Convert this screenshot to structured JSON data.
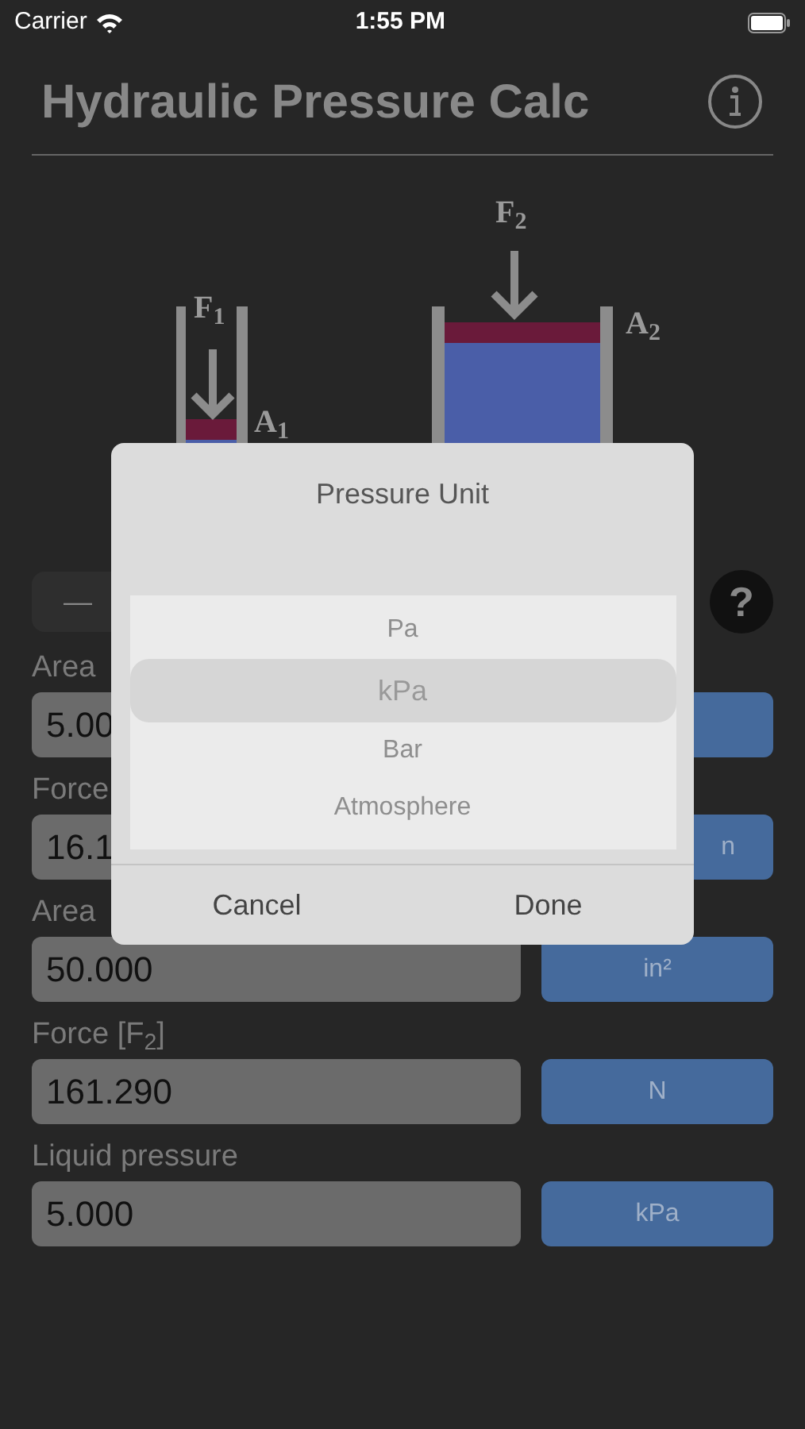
{
  "status_bar": {
    "carrier": "Carrier",
    "time": "1:55 PM"
  },
  "header": {
    "title": "Hydraulic Pressure Calc"
  },
  "diagram": {
    "labels": [
      {
        "kind": "f1",
        "text": "F$_{1}$"
      },
      {
        "kind": "a1",
        "text": "A$_{1}$"
      },
      {
        "kind": "f2",
        "text": "F$_{2}$"
      },
      {
        "kind": "a2",
        "text": "A$_{2}$"
      }
    ]
  },
  "toolbar": {
    "mode_button": "—",
    "help_button": "?"
  },
  "fields": [
    {
      "label": "Area",
      "value": "5.00"
    },
    {
      "label": "Force",
      "value": "16.1",
      "unit": "n"
    },
    {
      "label": "Area",
      "value": "50.000",
      "unit": "in²"
    },
    {
      "label": "Force [F$_{2}$]",
      "value": "161.290",
      "unit": "N"
    },
    {
      "label": "Liquid pressure",
      "value": "5.000",
      "unit": "kPa"
    }
  ],
  "dialog": {
    "title": "Pressure Unit",
    "options": [
      {
        "label": "Pa",
        "selected": false
      },
      {
        "label": "kPa",
        "selected": true
      },
      {
        "label": "Bar",
        "selected": false
      },
      {
        "label": "Atmosphere",
        "selected": false
      }
    ],
    "buttons": [
      "Cancel",
      "Done"
    ]
  }
}
